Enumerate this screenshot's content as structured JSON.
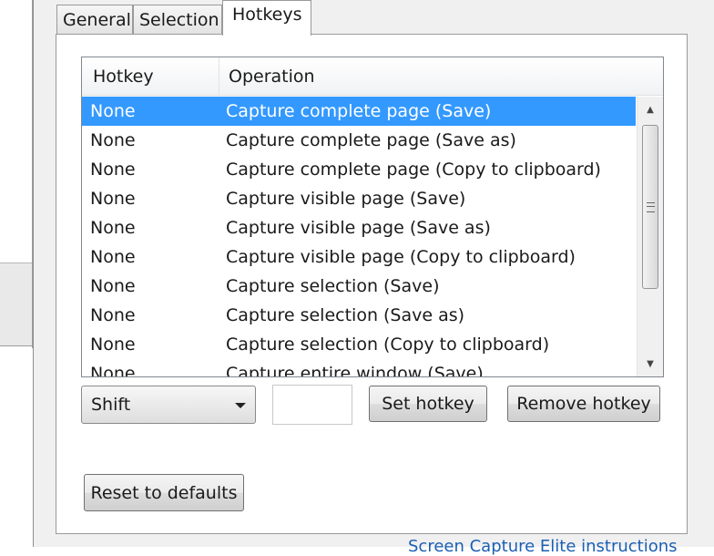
{
  "tabs": [
    {
      "label": "General"
    },
    {
      "label": "Selection"
    },
    {
      "label": "Hotkeys"
    }
  ],
  "active_tab": "Hotkeys",
  "list": {
    "columns": {
      "hotkey": "Hotkey",
      "operation": "Operation"
    },
    "rows": [
      {
        "hotkey": "None",
        "operation": "Capture complete page (Save)"
      },
      {
        "hotkey": "None",
        "operation": "Capture complete page (Save as)"
      },
      {
        "hotkey": "None",
        "operation": "Capture complete page (Copy to clipboard)"
      },
      {
        "hotkey": "None",
        "operation": "Capture visible page (Save)"
      },
      {
        "hotkey": "None",
        "operation": "Capture visible page (Save as)"
      },
      {
        "hotkey": "None",
        "operation": "Capture visible page (Copy to clipboard)"
      },
      {
        "hotkey": "None",
        "operation": "Capture selection (Save)"
      },
      {
        "hotkey": "None",
        "operation": "Capture selection (Save as)"
      },
      {
        "hotkey": "None",
        "operation": "Capture selection (Copy to clipboard)"
      },
      {
        "hotkey": "None",
        "operation": "Capture entire window (Save)"
      }
    ],
    "selected_index": 0
  },
  "modifier_select": {
    "value": "Shift"
  },
  "key_input": {
    "value": ""
  },
  "buttons": {
    "set_hotkey": "Set hotkey",
    "remove_hotkey": "Remove hotkey",
    "reset_defaults": "Reset to defaults"
  },
  "footer": {
    "link_text": "Screen Capture Elite instructions"
  },
  "colors": {
    "selection": "#3399ff",
    "dialog_bg": "#f0f0f0",
    "link": "#1a5fb4"
  }
}
